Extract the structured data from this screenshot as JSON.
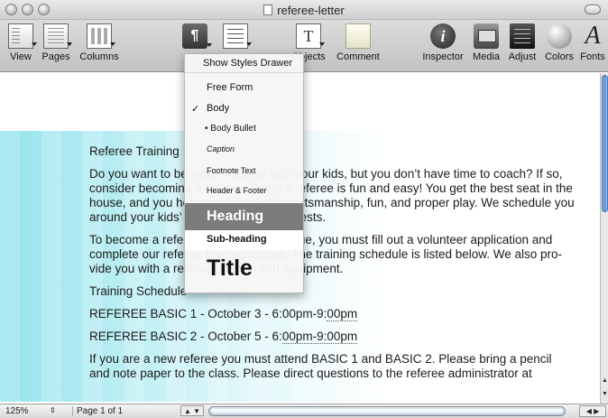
{
  "window": {
    "title": "referee-letter"
  },
  "toolbar": {
    "items": [
      {
        "label": "View"
      },
      {
        "label": "Pages"
      },
      {
        "label": "Columns"
      },
      {
        "label": "Styles"
      },
      {
        "label": "Lists"
      },
      {
        "label": "Objects"
      },
      {
        "label": "Comment"
      },
      {
        "label": "Inspector"
      },
      {
        "label": "Media"
      },
      {
        "label": "Adjust"
      },
      {
        "label": "Colors"
      },
      {
        "label": "Fonts"
      }
    ]
  },
  "styles_menu": {
    "header": "Show Styles Drawer",
    "items": [
      {
        "label": "Free Form",
        "checked": false
      },
      {
        "label": "Body",
        "checked": true
      },
      {
        "label": "• Body Bullet",
        "checked": false
      },
      {
        "label": "Caption",
        "checked": false
      },
      {
        "label": "Footnote Text",
        "checked": false
      },
      {
        "label": "Header & Footer",
        "checked": false
      },
      {
        "label": "Heading",
        "checked": false
      },
      {
        "label": "Sub-heading",
        "checked": false
      },
      {
        "label": "Title",
        "checked": false
      }
    ],
    "check_glyph": "✓"
  },
  "document": {
    "p1": "Referee Training",
    "p2": "Do you want to be more involved with your kids, but you don’t have time to coach? If so, consider becoming a referee. Being a referee is fun and easy! You get the best seat in the house, and you help teach the kids sportsmanship, fun, and proper play. We schedule you around your kids’ games and your requests.",
    "p3": "To become a referee for the youth league, you must fill out a volunteer application and complete our referee training course. The training schedule is listed below. We also pro-vide you with a referee uniform and equipment.",
    "p4": "Training Schedule",
    "p5_a": "REFEREE BASIC 1 - October 3 - 6:00pm-9:",
    "p5_b": "00pm",
    "p6_a": "REFEREE BASIC 2 - October 5 - 6:",
    "p6_b": "00pm-9:00pm",
    "p7": "If you are a new referee you must attend BASIC 1 and BASIC 2. Please bring a pencil and note paper to the class. Please direct questions to the referee administrator at"
  },
  "statusbar": {
    "zoom": "125%",
    "zoom_stepper": "⇕",
    "page": "Page 1 of 1",
    "prev_next": "▲ ▼",
    "h_arrows": "◀ ▶"
  },
  "colors": {
    "accent_band": "#00bfd3",
    "scroll_thumb": "#5a8fd0",
    "menu_highlight": "#7c7c7c"
  }
}
